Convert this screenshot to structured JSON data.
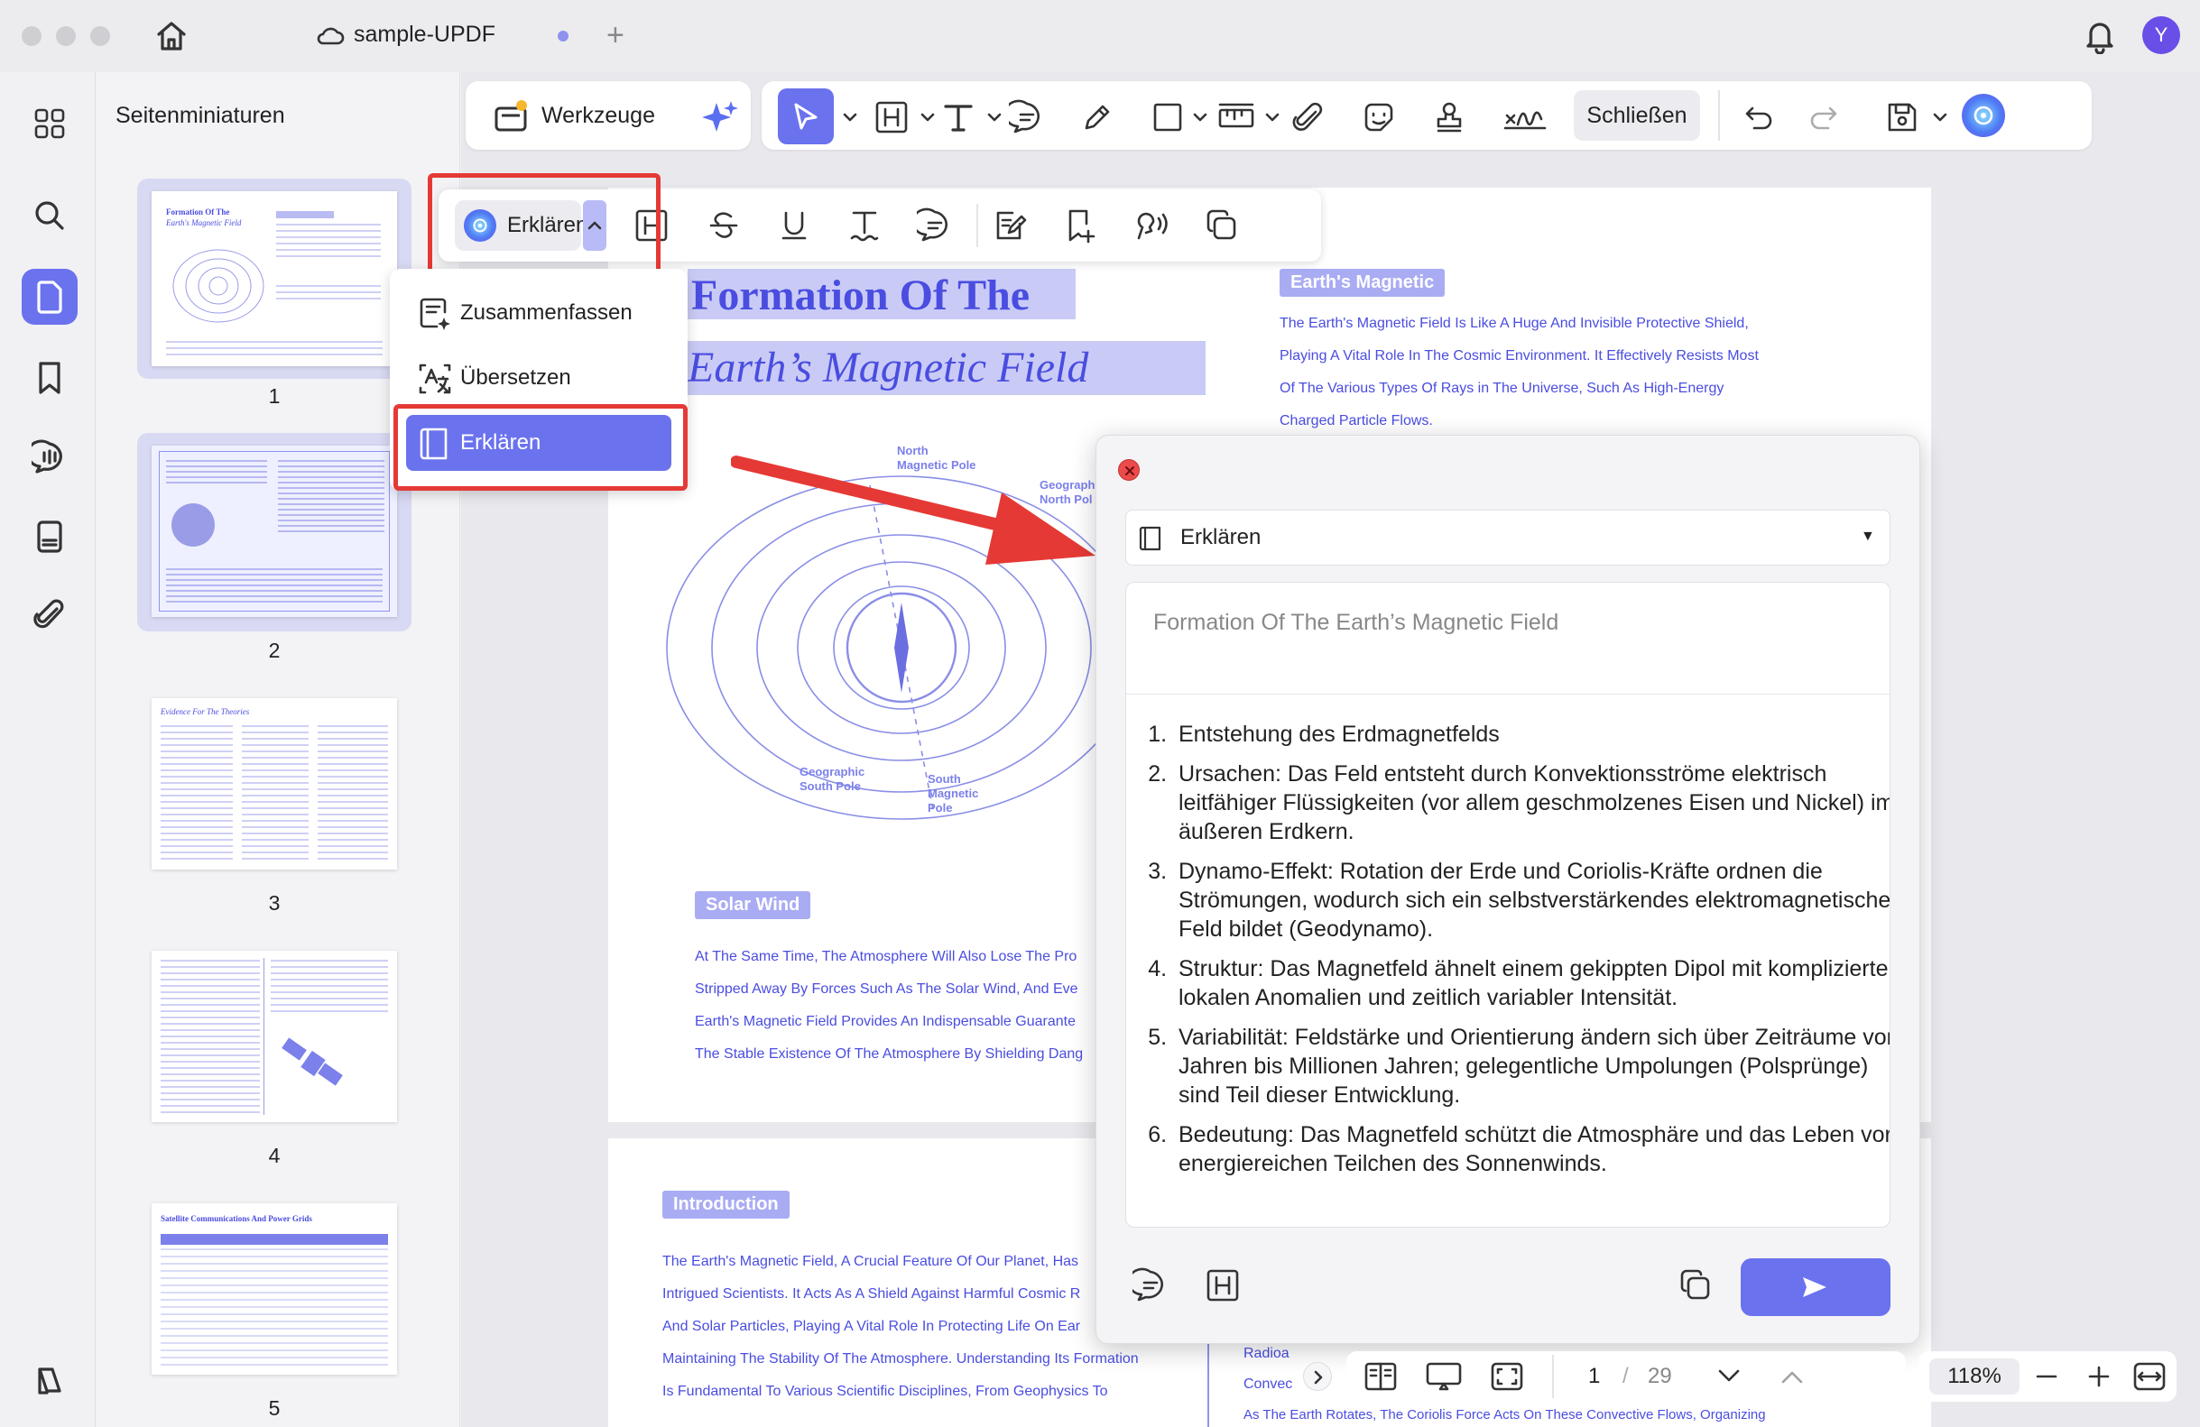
{
  "window": {
    "tab_title": "sample-UPDF",
    "avatar_letter": "Y"
  },
  "thumbnails": {
    "panel_title": "Seitenminiaturen",
    "pages": [
      "1",
      "2",
      "3",
      "4",
      "5"
    ],
    "page1_title_a": "Formation Of The",
    "page1_title_b": "Earth's Magnetic Field",
    "page3_title": "Evidence For The Theories",
    "page5_title": "Satellite Communications And Power Grids"
  },
  "toolbar": {
    "werkzeuge_label": "Werkzeuge",
    "schliessen_label": "Schließen"
  },
  "selection_toolbar": {
    "ai_label": "Erklären"
  },
  "ai_menu": {
    "items": [
      "Zusammenfassen",
      "Übersetzen",
      "Erklären"
    ],
    "active": "Erklären"
  },
  "document": {
    "title_line1": "Formation Of The",
    "title_line2": "Earth’s Magnetic Field",
    "section_magnetic": "Earth's Magnetic",
    "magnetic_lines": [
      "The Earth's Magnetic Field Is Like A Huge And Invisible Protective Shield,",
      "Playing A Vital Role In The Cosmic Environment. It Effectively Resists Most",
      "Of The Various Types Of Rays in The Universe, Such As High-Energy",
      "Charged Particle Flows."
    ],
    "diagram_labels": {
      "north_magnetic": "North\nMagnetic Pole",
      "geographic_north": "Geograph\nNorth Pol",
      "geographic_south": "Geographic\nSouth Pole",
      "south_magnetic": "South\nMagnetic\nPole"
    },
    "section_solar": "Solar Wind",
    "solar_lines": [
      "At The Same Time, The Atmosphere Will Also Lose The Pro",
      "Stripped Away By Forces Such As The Solar Wind, And Eve",
      "Earth's Magnetic Field Provides An Indispensable Guarante",
      "The Stable Existence Of The Atmosphere By Shielding Dang"
    ],
    "section_intro": "Introduction",
    "intro_lines": [
      "The Earth's Magnetic Field, A Crucial Feature Of Our Planet, Has",
      "Intrigued Scientists. It Acts As A Shield Against Harmful Cosmic R",
      "And Solar Particles, Playing A Vital Role In Protecting Life On Ear",
      "Maintaining The Stability Of The Atmosphere. Understanding Its Formation",
      "Is Fundamental To Various Scientific Disciplines, From Geophysics To"
    ],
    "right_col_a": "Radioa",
    "right_col_b": "Convec",
    "bottom_line": "As The Earth Rotates, The Coriolis Force Acts On These Convective Flows, Organizing"
  },
  "ai_panel": {
    "mode_label": "Erklären",
    "input_text": "Formation Of The Earth’s Magnetic Field",
    "results": [
      "Entstehung des Erdmagnetfelds",
      "Ursachen: Das Feld entsteht durch Konvektionsströme elektrisch leitfähiger Flüssigkeiten (vor allem geschmolzenes Eisen und Nickel) im äußeren Erdkern.",
      "Dynamo-Effekt: Rotation der Erde und Coriolis-Kräfte ordnen die Strömungen, wodurch sich ein selbstverstärkendes elektromagnetisches Feld bildet (Geodynamo).",
      "Struktur: Das Magnetfeld ähnelt einem gekippten Dipol mit komplizierten lokalen Anomalien und zeitlich variabler Intensität.",
      "Variabilität: Feldstärke und Orientierung ändern sich über Zeiträume von Jahren bis Millionen Jahren; gelegentliche Umpolungen (Polsprünge) sind Teil dieser Entwicklung.",
      "Bedeutung: Das Magnetfeld schützt die Atmosphäre und das Leben vor energiereichen Teilchen des Sonnenwinds."
    ]
  },
  "bottom_bar": {
    "current_page": "1",
    "separator": "/",
    "total_pages": "29",
    "zoom": "118%"
  },
  "colors": {
    "accent": "#6a72ee",
    "highlight_red": "#e53935",
    "doc_text": "#4a4de0"
  }
}
